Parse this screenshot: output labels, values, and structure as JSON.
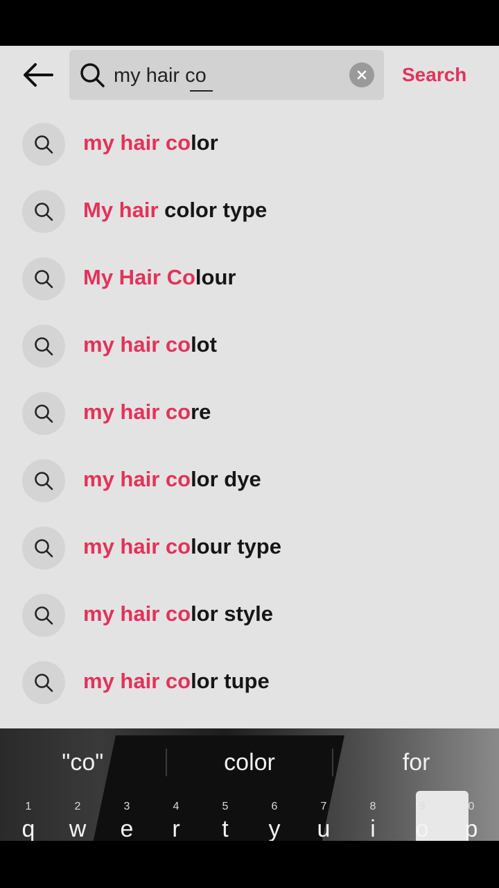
{
  "search": {
    "query": "my hair co",
    "submit_label": "Search"
  },
  "suggestions": [
    {
      "highlight": "my hair co",
      "rest": "lor"
    },
    {
      "highlight": "My hair",
      "rest": " color type"
    },
    {
      "highlight": "My Hair Co",
      "rest": "lour"
    },
    {
      "highlight": "my hair co",
      "rest": "lot"
    },
    {
      "highlight": "my hair co",
      "rest": "re"
    },
    {
      "highlight": "my hair co",
      "rest": "lor dye"
    },
    {
      "highlight": "my hair co",
      "rest": "lour type"
    },
    {
      "highlight": "my hair co",
      "rest": "lor style"
    },
    {
      "highlight": "my hair co",
      "rest": "lor tupe"
    }
  ],
  "keyboard": {
    "predictions": [
      "\"co\"",
      "color",
      "for"
    ],
    "keys": [
      {
        "num": "1",
        "letter": "q"
      },
      {
        "num": "2",
        "letter": "w"
      },
      {
        "num": "3",
        "letter": "e"
      },
      {
        "num": "4",
        "letter": "r"
      },
      {
        "num": "5",
        "letter": "t"
      },
      {
        "num": "6",
        "letter": "y"
      },
      {
        "num": "7",
        "letter": "u"
      },
      {
        "num": "8",
        "letter": "i"
      },
      {
        "num": "9",
        "letter": "o"
      },
      {
        "num": "0",
        "letter": "p"
      }
    ]
  },
  "colors": {
    "accent": "#e3325a",
    "background": "#e3e3e3",
    "search_field": "#d2d2d2"
  }
}
